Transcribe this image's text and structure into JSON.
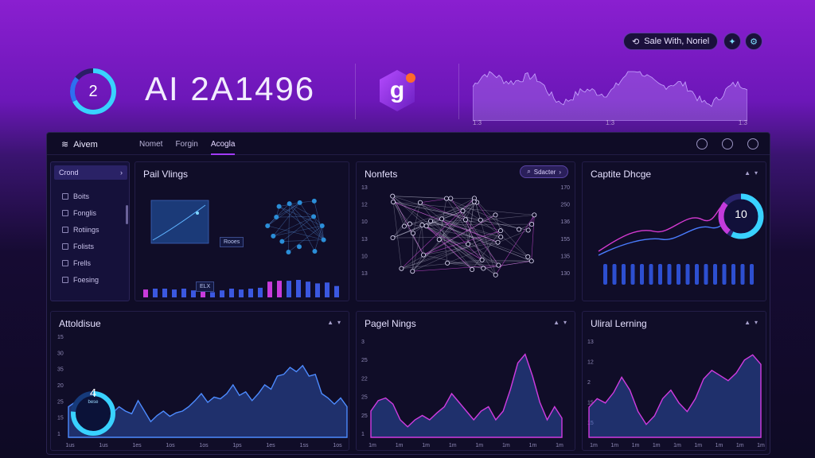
{
  "hero": {
    "badge_value": "2",
    "title": "AI 2A1496",
    "logo_letter": "g",
    "spark_ticks": [
      "1:3",
      "1:3",
      "1:3"
    ],
    "pill_label": "Sale With, Noriel"
  },
  "colors": {
    "accent": "#a33bff",
    "cyan": "#37d0ff",
    "magenta": "#e23bd6",
    "blue": "#3f6df0"
  },
  "app": {
    "brand": "Aivem",
    "tabs": [
      "Nomet",
      "Forgin",
      "Acogla"
    ],
    "active_tab": 2
  },
  "sidebar": {
    "head": "Crond",
    "items": [
      {
        "label": "Boits",
        "icon": "grid-icon"
      },
      {
        "label": "Fonglis",
        "icon": "layers-icon"
      },
      {
        "label": "Rotiings",
        "icon": "list-icon"
      },
      {
        "label": "Folists",
        "icon": "user-icon"
      },
      {
        "label": "Frells",
        "icon": "filter-icon"
      },
      {
        "label": "Foesing",
        "icon": "check-icon"
      }
    ]
  },
  "panels": {
    "p1": {
      "title": "Pail Vlings",
      "card_a": "Rooes",
      "card_b": "ELX"
    },
    "p2": {
      "title": "Nonfets",
      "search": "Sdacter",
      "ticks_l": [
        "13",
        "12",
        "10",
        "13",
        "10",
        "13"
      ],
      "ticks_r": [
        "170",
        "250",
        "136",
        "155",
        "135",
        "130"
      ]
    },
    "p3": {
      "title": "Captite Dhcge",
      "donut_value": "10"
    },
    "p4": {
      "title": "Attoldisue",
      "donut_value": "4",
      "donut_sub": "bese",
      "ticks_y": [
        "15",
        "30",
        "35",
        "20",
        "25",
        "15",
        "1"
      ],
      "ticks_x": [
        "1us",
        "1us",
        "1es",
        "1os",
        "1os",
        "1ps",
        "1es",
        "1ss",
        "1os"
      ]
    },
    "p5": {
      "title": "Pagel Nings",
      "ticks_y": [
        "3",
        "25",
        "22",
        "25",
        "25",
        "1"
      ],
      "ticks_x": [
        "1m",
        "1m",
        "1m",
        "1m",
        "1m",
        "1m",
        "1m",
        "1m"
      ]
    },
    "p6": {
      "title": "Uliral Lerning",
      "ticks_y": [
        "13",
        "12",
        "2",
        "15",
        "15"
      ],
      "ticks_x": [
        "1m",
        "1m",
        "1m",
        "1m",
        "1m",
        "1m",
        "1m",
        "1m",
        "1m"
      ]
    }
  }
}
